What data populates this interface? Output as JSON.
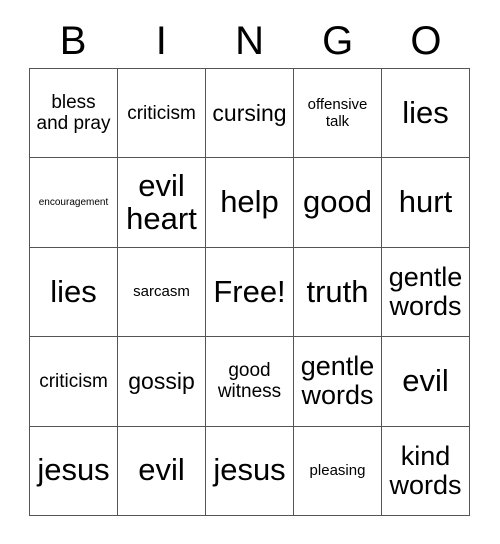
{
  "card": {
    "title": "BINGO",
    "header_letters": [
      "B",
      "I",
      "N",
      "G",
      "O"
    ],
    "free_space_label": "Free!",
    "grid_color": "#555555",
    "text_color": "#000000",
    "background_color": "#ffffff",
    "rows": [
      [
        {
          "text": "bless and pray",
          "size": "md"
        },
        {
          "text": "criticism",
          "size": "md"
        },
        {
          "text": "cursing",
          "size": "lg"
        },
        {
          "text": "offensive talk",
          "size": "sm"
        },
        {
          "text": "lies",
          "size": "xxl"
        }
      ],
      [
        {
          "text": "encouragement",
          "size": "xs"
        },
        {
          "text": "evil heart",
          "size": "xxl"
        },
        {
          "text": "help",
          "size": "xxl"
        },
        {
          "text": "good",
          "size": "xxl"
        },
        {
          "text": "hurt",
          "size": "xxl"
        }
      ],
      [
        {
          "text": "lies",
          "size": "xxl"
        },
        {
          "text": "sarcasm",
          "size": "sm"
        },
        {
          "text": "Free!",
          "size": "xxl"
        },
        {
          "text": "truth",
          "size": "xxl"
        },
        {
          "text": "gentle words",
          "size": "xl"
        }
      ],
      [
        {
          "text": "criticism",
          "size": "md"
        },
        {
          "text": "gossip",
          "size": "lg"
        },
        {
          "text": "good witness",
          "size": "md"
        },
        {
          "text": "gentle words",
          "size": "xl"
        },
        {
          "text": "evil",
          "size": "xxl"
        }
      ],
      [
        {
          "text": "jesus",
          "size": "xxl"
        },
        {
          "text": "evil",
          "size": "xxl"
        },
        {
          "text": "jesus",
          "size": "xxl"
        },
        {
          "text": "pleasing",
          "size": "sm"
        },
        {
          "text": "kind words",
          "size": "xl"
        }
      ]
    ]
  }
}
